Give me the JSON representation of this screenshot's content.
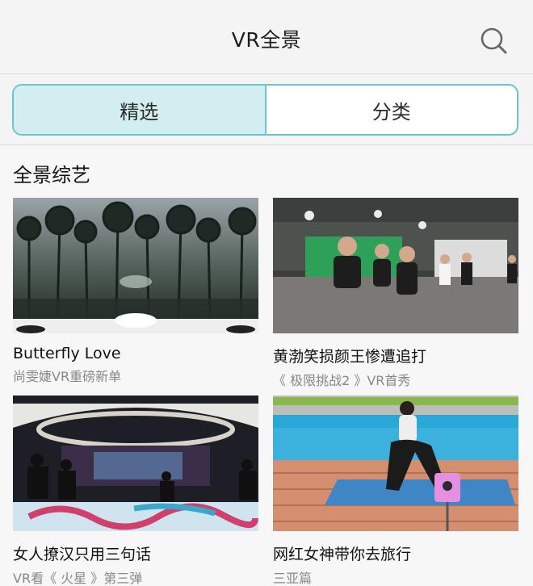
{
  "header": {
    "title": "VR全景",
    "search_icon": "search-icon"
  },
  "tabs": [
    {
      "label": "精选",
      "active": true
    },
    {
      "label": "分类",
      "active": false
    }
  ],
  "section": {
    "title": "全景综艺"
  },
  "videos": [
    {
      "title": "Butterfly Love",
      "subtitle": "尚雯婕VR重磅新单"
    },
    {
      "title": "黄渤笑损颜王惨遭追打",
      "subtitle": "《 极限挑战2 》VR首秀"
    },
    {
      "title": "女人撩汉只用三句话",
      "subtitle": "VR看《 火星 》第三弹"
    },
    {
      "title": "网红女神带你去旅行",
      "subtitle": "三亚篇"
    }
  ],
  "colors": {
    "accent": "#67c6c9",
    "active_tab_bg": "#d3eef0"
  }
}
